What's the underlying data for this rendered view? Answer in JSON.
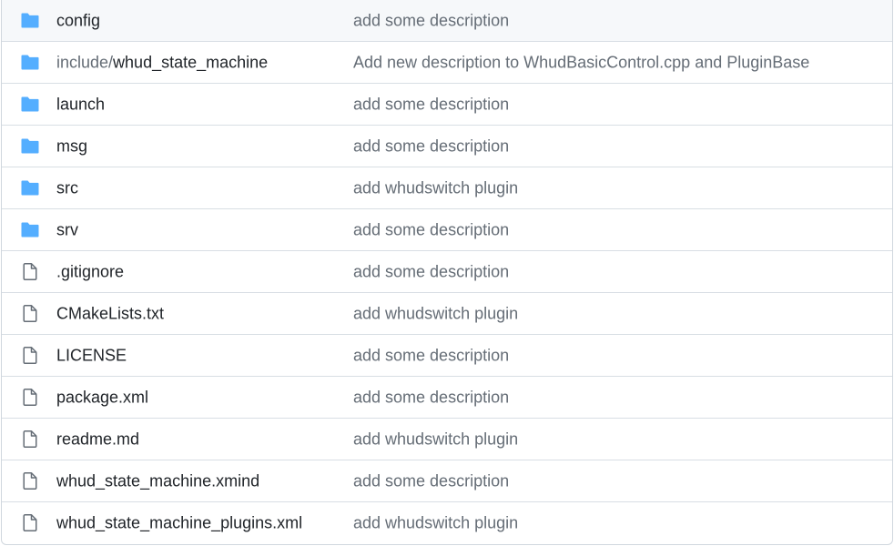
{
  "colors": {
    "folder_icon": "#54aeff",
    "file_icon": "#656d76",
    "text": "#1f2328",
    "muted": "#656d76",
    "border": "#d0d7de"
  },
  "files": [
    {
      "type": "folder",
      "icon": "folder-icon",
      "prefix": "",
      "name": "config",
      "message": "add some description"
    },
    {
      "type": "folder",
      "icon": "folder-icon",
      "prefix": "include/",
      "name": "whud_state_machine",
      "message": "Add new description to WhudBasicControl.cpp and PluginBase"
    },
    {
      "type": "folder",
      "icon": "folder-icon",
      "prefix": "",
      "name": "launch",
      "message": "add some description"
    },
    {
      "type": "folder",
      "icon": "folder-icon",
      "prefix": "",
      "name": "msg",
      "message": "add some description"
    },
    {
      "type": "folder",
      "icon": "folder-icon",
      "prefix": "",
      "name": "src",
      "message": "add whudswitch plugin"
    },
    {
      "type": "folder",
      "icon": "folder-icon",
      "prefix": "",
      "name": "srv",
      "message": "add some description"
    },
    {
      "type": "file",
      "icon": "file-icon",
      "prefix": "",
      "name": ".gitignore",
      "message": "add some description"
    },
    {
      "type": "file",
      "icon": "file-icon",
      "prefix": "",
      "name": "CMakeLists.txt",
      "message": "add whudswitch plugin"
    },
    {
      "type": "file",
      "icon": "file-icon",
      "prefix": "",
      "name": "LICENSE",
      "message": "add some description"
    },
    {
      "type": "file",
      "icon": "file-icon",
      "prefix": "",
      "name": "package.xml",
      "message": "add some description"
    },
    {
      "type": "file",
      "icon": "file-icon",
      "prefix": "",
      "name": "readme.md",
      "message": "add whudswitch plugin"
    },
    {
      "type": "file",
      "icon": "file-icon",
      "prefix": "",
      "name": "whud_state_machine.xmind",
      "message": "add some description"
    },
    {
      "type": "file",
      "icon": "file-icon",
      "prefix": "",
      "name": "whud_state_machine_plugins.xml",
      "message": "add whudswitch plugin"
    }
  ]
}
